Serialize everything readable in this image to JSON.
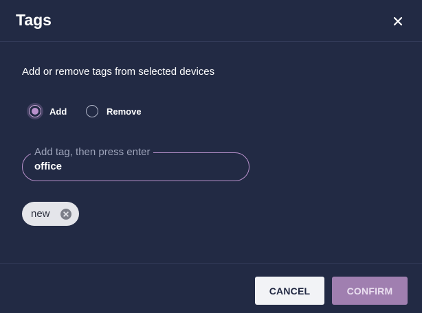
{
  "dialog": {
    "title": "Tags",
    "description": "Add or remove tags from selected devices",
    "mode": {
      "options": [
        {
          "label": "Add",
          "selected": true
        },
        {
          "label": "Remove",
          "selected": false
        }
      ]
    },
    "tag_input": {
      "label": "Add tag, then press enter",
      "value": "office"
    },
    "chips": [
      {
        "label": "new",
        "delete_icon": "cancel-circle-icon"
      }
    ],
    "footer": {
      "cancel_label": "CANCEL",
      "confirm_label": "CONFIRM"
    },
    "colors": {
      "background": "#222a44",
      "accent": "#b991cc",
      "confirm_button": "#a07fb0",
      "cancel_button": "#f2f3f6",
      "chip": "#e4e5ea"
    }
  }
}
